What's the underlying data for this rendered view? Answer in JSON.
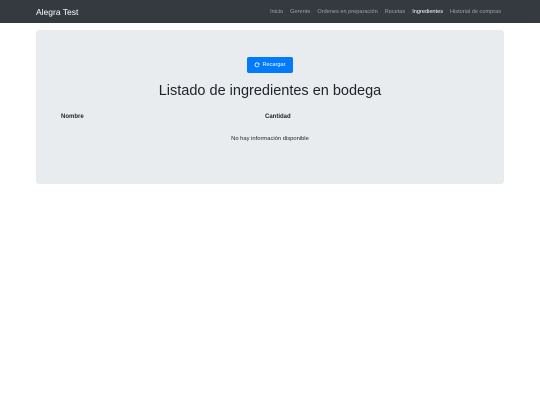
{
  "navbar": {
    "brand": "Alegra Test",
    "links": [
      {
        "label": "Inicio"
      },
      {
        "label": "Gerente"
      },
      {
        "label": "Ordenes en preparación"
      },
      {
        "label": "Recetas"
      },
      {
        "label": "Ingredientes",
        "active": true
      },
      {
        "label": "Historial de compras"
      }
    ]
  },
  "main": {
    "reload_label": "Recargar",
    "title": "Listado de ingredientes en bodega",
    "table": {
      "columns": [
        "Nombre",
        "Cantidad"
      ],
      "empty_message": "No hay información disponible"
    }
  },
  "colors": {
    "navbar_bg": "#343a40",
    "primary": "#007bff",
    "panel_bg": "#e9ecef"
  },
  "icons": {
    "reload": "refresh-icon"
  }
}
